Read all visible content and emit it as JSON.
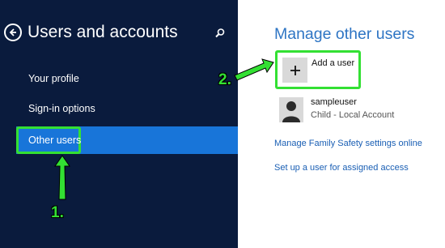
{
  "left_panel": {
    "title": "Users and accounts",
    "nav": [
      {
        "label": "Your profile"
      },
      {
        "label": "Sign-in options"
      },
      {
        "label": "Other users",
        "selected": true
      }
    ],
    "back_icon": "back-arrow-circle-icon",
    "search_icon": "search-icon"
  },
  "right_panel": {
    "title": "Manage other users",
    "add_user": {
      "label": "Add a user",
      "icon": "plus-icon"
    },
    "account": {
      "name": "sampleuser",
      "type": "Child - Local Account",
      "icon": "user-silhouette-icon"
    },
    "links": [
      "Manage Family Safety settings online",
      "Set up a user for assigned access"
    ]
  },
  "annotations": {
    "step1": "1.",
    "step2": "2."
  },
  "colors": {
    "left_bg": "#0a1b3d",
    "selected_bg": "#1875d9",
    "accent_title": "#2e75c4",
    "link": "#1a5fb4",
    "highlight": "#33e033"
  }
}
